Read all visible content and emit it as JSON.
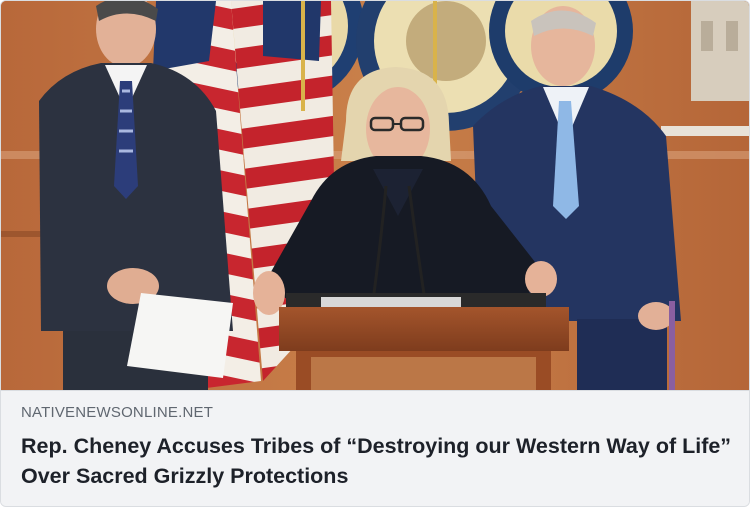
{
  "link_preview": {
    "image_alt": "",
    "source_domain": "NATIVENEWSONLINE.NET",
    "headline": "Rep. Cheney Accuses Tribes of “Destroying our Western Way of Life” Over Sacred Grizzly Protections"
  },
  "colors": {
    "caption_background": "#f2f3f5",
    "domain_text": "#606770",
    "headline_text": "#1d2129",
    "border": "#dadde1"
  }
}
